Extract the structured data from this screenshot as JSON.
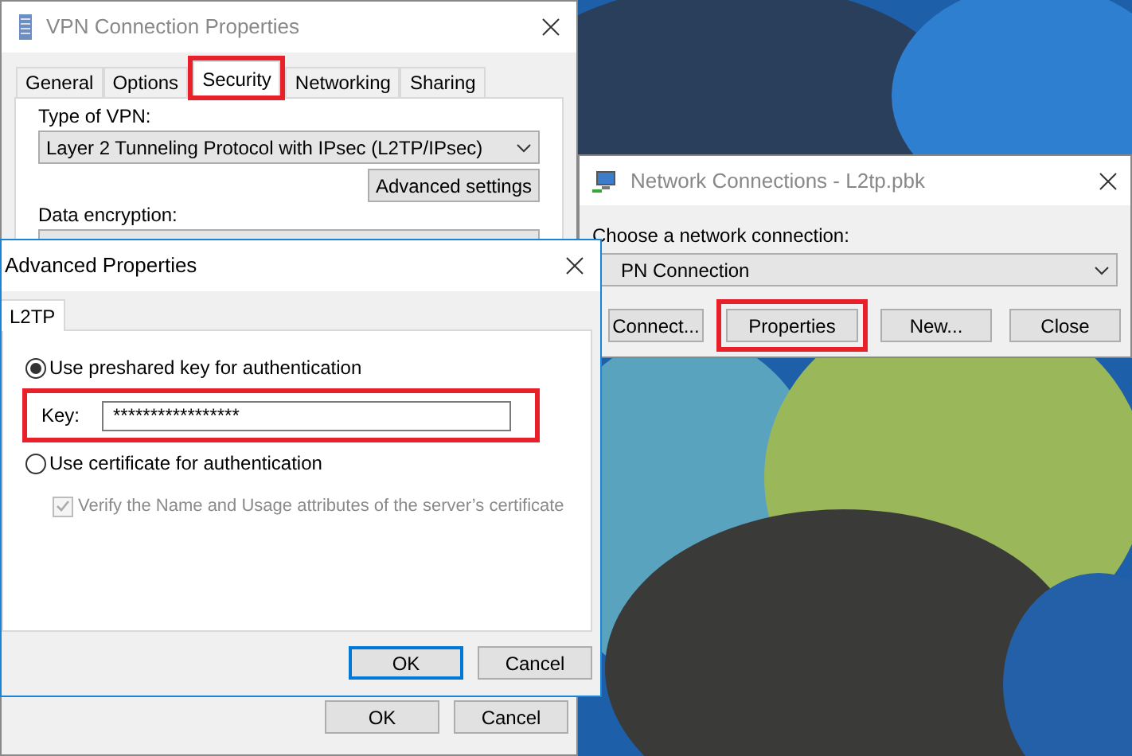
{
  "vpn_window": {
    "title": "VPN Connection Properties",
    "tabs": [
      {
        "label": "General",
        "selected": false,
        "highlight": false
      },
      {
        "label": "Options",
        "selected": false,
        "highlight": false
      },
      {
        "label": "Security",
        "selected": true,
        "highlight": true
      },
      {
        "label": "Networking",
        "selected": false,
        "highlight": false
      },
      {
        "label": "Sharing",
        "selected": false,
        "highlight": false
      }
    ],
    "type_label": "Type of VPN:",
    "type_value": "Layer 2 Tunneling Protocol with IPsec (L2TP/IPsec)",
    "advanced_button": "Advanced settings",
    "encryption_label": "Data encryption:",
    "buttons": [
      "OK",
      "Cancel"
    ]
  },
  "network_window": {
    "title": "Network Connections - L2tp.pbk",
    "label": "Choose a network connection:",
    "value": "PN Connection",
    "buttons": [
      {
        "label": "Connect...",
        "highlight": false
      },
      {
        "label": "Properties",
        "highlight": true
      },
      {
        "label": "New...",
        "highlight": false
      },
      {
        "label": "Close",
        "highlight": false
      }
    ]
  },
  "advanced_dialog": {
    "title": "Advanced Properties",
    "tabs": [
      {
        "label": "L2TP",
        "selected": true
      }
    ],
    "options": [
      {
        "kind": "radio",
        "label": "Use preshared key for authentication",
        "selected": true
      },
      {
        "kind": "key",
        "label": "Key:",
        "value": "*****************",
        "highlight": true
      },
      {
        "kind": "radio",
        "label": "Use certificate for authentication",
        "selected": false
      },
      {
        "kind": "checkbox",
        "label": "Verify the Name and Usage attributes of the server’s certificate",
        "checked": true,
        "disabled": true
      }
    ],
    "buttons": [
      {
        "label": "OK",
        "default": true
      },
      {
        "label": "Cancel",
        "default": false
      }
    ]
  }
}
